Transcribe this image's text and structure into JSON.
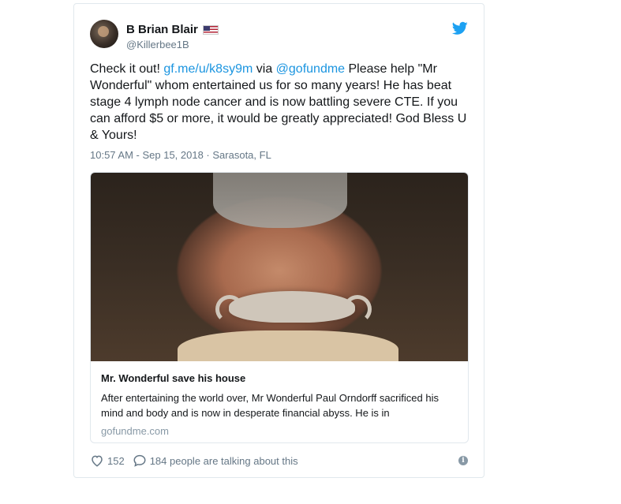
{
  "author": {
    "display_name": "B Brian Blair",
    "handle": "@Killerbee1B"
  },
  "icons": {
    "avatar": "avatar",
    "flag": "us-flag-icon",
    "twitter": "twitter-bird-icon",
    "heart": "heart-icon",
    "comment": "comment-icon",
    "info": "info-icon"
  },
  "tweet": {
    "text_1": "Check it out! ",
    "link_1": "gf.me/u/k8sy9m",
    "text_2": " via ",
    "link_2": "@gofundme",
    "text_3": " Please help \"Mr Wonderful\" whom entertained us for so many years! He has beat stage 4 lymph node cancer and is now battling severe CTE. If you can afford $5 or more, it would be greatly appreciated! God Bless U & Yours!",
    "timestamp": "10:57 AM - Sep 15, 2018 · Sarasota, FL"
  },
  "card": {
    "title": "Mr. Wonderful save his house",
    "description": "After entertaining the world over, Mr Wonderful Paul Orndorff sacrificed his mind and body and is now in desperate financial abyss. He is in",
    "domain": "gofundme.com"
  },
  "footer": {
    "likes": "152",
    "talking": "184 people are talking about this",
    "info": "i"
  },
  "colors": {
    "link": "#1b95e0",
    "text": "#14171a",
    "muted": "#657786"
  }
}
